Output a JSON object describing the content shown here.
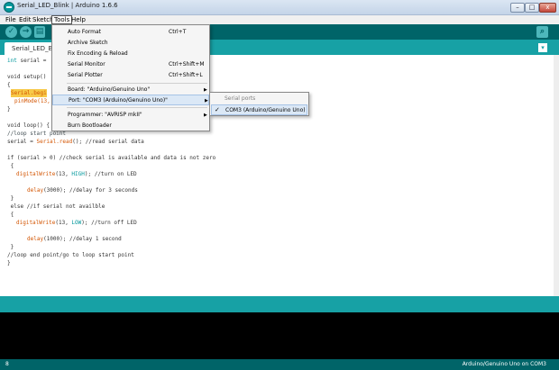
{
  "window": {
    "title": "Serial_LED_Blink | Arduino 1.6.6",
    "min_label": "–",
    "max_label": "□",
    "close_label": "x"
  },
  "menubar": {
    "file": "File",
    "edit": "Edit",
    "sketch": "Sketch",
    "tools": "Tools",
    "help": "Help"
  },
  "toolbar": {
    "verify_icon": "✓",
    "upload_icon": "→",
    "new_icon": "▤",
    "monitor_icon": "⌕"
  },
  "tab": {
    "name": "Serial_LED_Bli",
    "menu_icon": "▾"
  },
  "tools_menu": {
    "auto_format": "Auto Format",
    "auto_format_shortcut": "Ctrl+T",
    "archive_sketch": "Archive Sketch",
    "fix_encoding": "Fix Encoding & Reload",
    "serial_monitor": "Serial Monitor",
    "serial_monitor_shortcut": "Ctrl+Shift+M",
    "serial_plotter": "Serial Plotter",
    "serial_plotter_shortcut": "Ctrl+Shift+L",
    "board": "Board: \"Arduino/Genuino Uno\"",
    "port": "Port: \"COM3 (Arduino/Genuino Uno)\"",
    "programmer": "Programmer: \"AVRISP mkII\"",
    "burn_bootloader": "Burn Bootloader",
    "submenu_arrow": "▶"
  },
  "ports_menu": {
    "header": "Serial ports",
    "check": "✓",
    "port": "COM3 (Arduino/Genuino Uno)"
  },
  "code": {
    "l1": "int serial = ",
    "l2": "void setup()",
    "l3": "{",
    "l4": "Serial.begi",
    "l5": "pinMode(13,",
    "l6": "}",
    "l7": "void loop() {",
    "l8": "//loop start point",
    "l9a": "serial = ",
    "l9b": "Serial.read",
    "l9c": "(); //read serial data",
    "l10": "if (serial > 0) //check serial is available and data is not zero",
    "l11": " {",
    "l12a": "digitalWrite",
    "l12b": "(13, ",
    "l12c": "HIGH",
    "l12d": "); //turn on LED",
    "l13a": "delay",
    "l13b": "(3000); //delay for 3 seconds",
    "l14": " }",
    "l15": " else //if serial not availble",
    "l16": " {",
    "l17a": "digitalWrite",
    "l17b": "(13, ",
    "l17c": "LOW",
    "l17d": "); //turn off LED",
    "l18a": "delay",
    "l18b": "(1000); //delay 1 second",
    "l19": " }",
    "l20": "//loop end point/go to loop start point",
    "l21": "}"
  },
  "footer": {
    "line": "8",
    "board": "Arduino/Genuino Uno on COM3"
  },
  "colors": {
    "toolbar": "#006468",
    "tabbar": "#17a1a5",
    "keyword": "#00979c",
    "function": "#d35400"
  }
}
